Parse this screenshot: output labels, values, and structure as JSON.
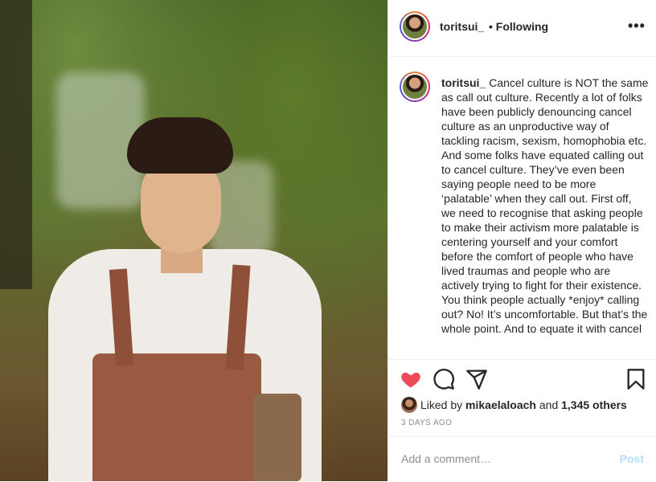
{
  "post": {
    "username": "toritsui_",
    "follow_status": "• Following",
    "more_label": "•••",
    "caption_username": "toritsui_",
    "caption": "Cancel culture is NOT the same as call out culture. Recently a lot of folks have been publicly denouncing cancel culture as an unproductive way of tackling racism, sexism, homophobia etc. And some folks have equated calling out to cancel culture. They’ve even been saying people need to be more ‘palatable’ when they call out. First off, we need to recognise that asking people to make their activism more palatable is centering yourself and your comfort before the comfort of people who have lived traumas and people who are actively trying to fight for their existence. You think people actually *enjoy* calling out? No! It’s uncomfortable. But that’s the whole point. And to equate it with cancel",
    "liked_prefix": "Liked by",
    "liked_user": "mikaelaloach",
    "liked_and": "and",
    "liked_others": "1,345 others",
    "time_ago": "3 DAYS AGO"
  },
  "icons": [
    "heart-icon",
    "comment-icon",
    "share-icon",
    "bookmark-icon",
    "more-icon"
  ],
  "colors": {
    "heart": "#ed4956",
    "post_disabled": "#b2dffc",
    "muted": "#8e8e8e"
  },
  "comment_box": {
    "placeholder": "Add a comment…",
    "post_label": "Post"
  }
}
